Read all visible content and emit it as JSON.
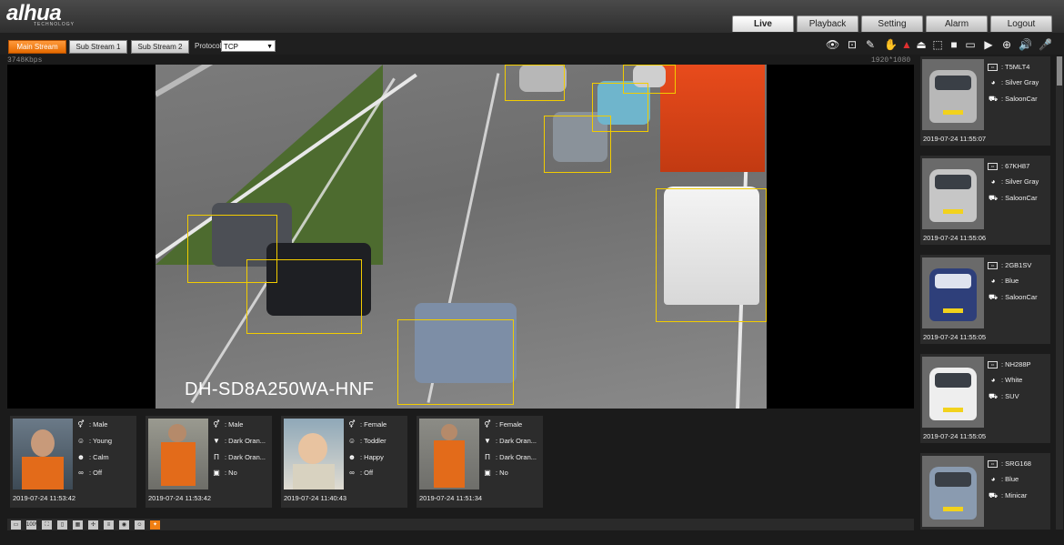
{
  "header": {
    "logo_text": "alhua",
    "logo_sub": "TECHNOLOGY",
    "tabs": [
      "Live",
      "Playback",
      "Setting",
      "Alarm",
      "Logout"
    ],
    "active_tab": "Live"
  },
  "toolbar": {
    "streams": [
      "Main Stream",
      "Sub Stream 1",
      "Sub Stream 2"
    ],
    "active_stream": "Main Stream",
    "protocol_label": "Protocol",
    "protocol_value": "TCP",
    "bitrate": "3748Kbps",
    "resolution": "1920*1080",
    "icons": [
      "eye-icon",
      "snapshot-icon",
      "pen-icon",
      "hand-icon",
      "alarm-light-icon",
      "bell-icon",
      "region-icon",
      "record-icon",
      "image-icon",
      "video-icon",
      "target-icon",
      "speaker-icon",
      "mic-icon"
    ]
  },
  "video": {
    "overlay_text": "DH-SD8A250WA-HNF",
    "box_color": "#f2cc00"
  },
  "faces": [
    {
      "attrs": [
        {
          "icon": "gender-icon",
          "value": ": Male"
        },
        {
          "icon": "age-icon",
          "value": ": Young"
        },
        {
          "icon": "face-icon",
          "value": ": Calm"
        },
        {
          "icon": "glasses-icon",
          "value": ": Off"
        }
      ],
      "time": "2019-07-24 11:53:42"
    },
    {
      "attrs": [
        {
          "icon": "gender-icon",
          "value": ": Male"
        },
        {
          "icon": "shirt-icon",
          "value": ": Dark Oran..."
        },
        {
          "icon": "pants-icon",
          "value": ": Dark Oran..."
        },
        {
          "icon": "bag-icon",
          "value": ": No"
        }
      ],
      "time": "2019-07-24 11:53:42"
    },
    {
      "attrs": [
        {
          "icon": "gender-icon",
          "value": ": Female"
        },
        {
          "icon": "age-icon",
          "value": ": Toddler"
        },
        {
          "icon": "face-icon",
          "value": ": Happy"
        },
        {
          "icon": "glasses-icon",
          "value": ": Off"
        }
      ],
      "time": "2019-07-24 11:40:43"
    },
    {
      "attrs": [
        {
          "icon": "gender-icon",
          "value": ": Female"
        },
        {
          "icon": "shirt-icon",
          "value": ": Dark Oran..."
        },
        {
          "icon": "pants-icon",
          "value": ": Dark Oran..."
        },
        {
          "icon": "bag-icon",
          "value": ": No"
        }
      ],
      "time": "2019-07-24 11:51:34"
    }
  ],
  "vehicles": [
    {
      "plate": ": T5MLT4",
      "color": ": Silver Gray",
      "type": ": SaloonCar",
      "time": "2019-07-24 11:55:07",
      "car_color": "#b8b8b8"
    },
    {
      "plate": ": 67KH87",
      "color": ": Silver Gray",
      "type": ": SaloonCar",
      "time": "2019-07-24 11:55:06",
      "car_color": "#c6c6c6"
    },
    {
      "plate": ": 2GB1SV",
      "color": ": Blue",
      "type": ": SaloonCar",
      "time": "2019-07-24 11:55:05",
      "car_color": "#2e3f7a"
    },
    {
      "plate": ": NH288P",
      "color": ": White",
      "type": ": SUV",
      "time": "2019-07-24 11:55:05",
      "car_color": "#eeeeee"
    },
    {
      "plate": ": SRG168",
      "color": ": Blue",
      "type": ": Minicar",
      "time": "",
      "car_color": "#8a9bb0"
    }
  ],
  "bottom_icons": [
    "window-icon",
    "100%",
    "fullscreen-icon",
    "ratio-icon",
    "grid-icon",
    "move-icon",
    "ptz-icon",
    "snapshot-icon",
    "face-detect-icon",
    "settings-icon"
  ]
}
